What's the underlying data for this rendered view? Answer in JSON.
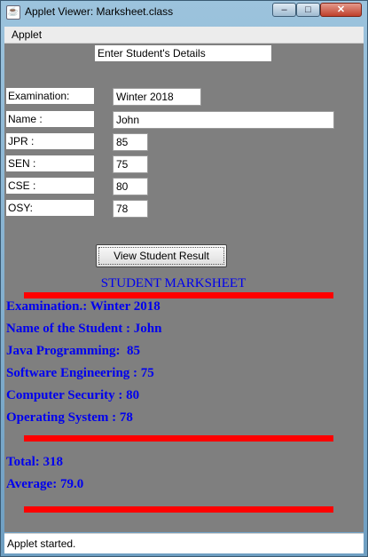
{
  "window": {
    "title": "Applet Viewer: Marksheet.class",
    "icon": "java-applet-icon",
    "controls": {
      "minimize": "–",
      "maximize": "□",
      "close": "✕"
    }
  },
  "menubar": {
    "items": [
      "Applet"
    ]
  },
  "form": {
    "header": "Enter Student's Details",
    "fields": [
      {
        "label": "Examination:",
        "value": "Winter 2018"
      },
      {
        "label": "Name :",
        "value": "John"
      },
      {
        "label": "JPR :",
        "value": "85"
      },
      {
        "label": "SEN :",
        "value": "75"
      },
      {
        "label": "CSE :",
        "value": "80"
      },
      {
        "label": "OSY:",
        "value": "78"
      }
    ],
    "submit_label": "View Student Result"
  },
  "result": {
    "title": "STUDENT MARKSHEET",
    "examination": "Examination.: Winter 2018",
    "student_name": "Name of the Student : John",
    "java": "Java Programming:  85",
    "software": "Software Engineering : 75",
    "security": "Computer Security : 80",
    "os": "Operating System : 78",
    "total": "Total: 318",
    "average": "Average: 79.0"
  },
  "status": "Applet started.",
  "colors": {
    "canvas_bg": "#7f7f7f",
    "result_text": "#0000ee",
    "divider": "#ff0000"
  }
}
